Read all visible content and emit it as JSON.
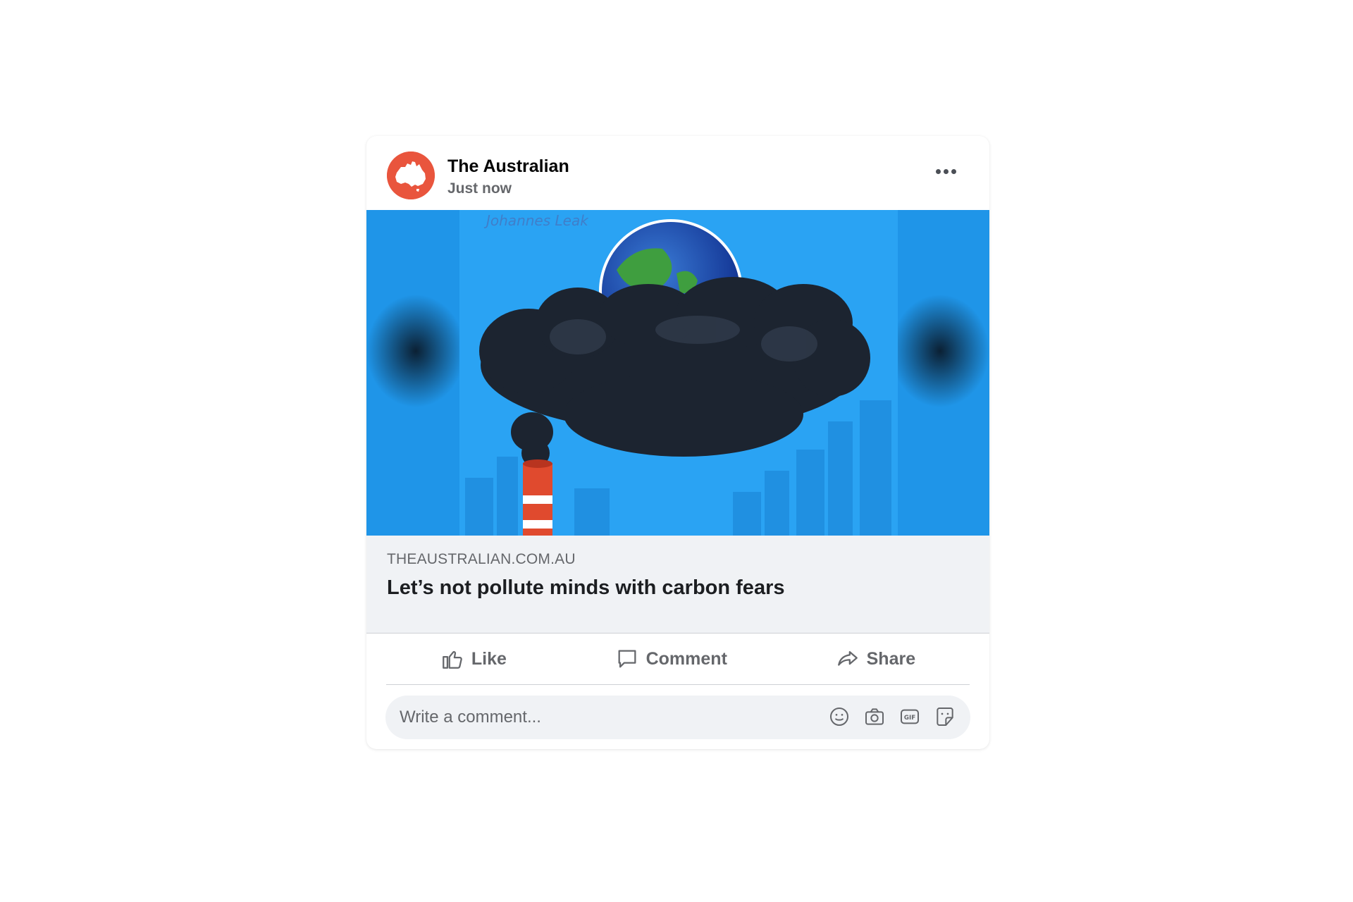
{
  "post": {
    "page_name": "The Australian",
    "timestamp": "Just now",
    "avatar_icon": "australia-map-icon",
    "more_icon": "more-options-icon"
  },
  "image": {
    "description_icon": "cartoon-earth-smoke-cloud-image",
    "signature": "Johannes Leak"
  },
  "link": {
    "domain": "THEAUSTRALIAN.COM.AU",
    "title": "Let’s not pollute minds with carbon fears"
  },
  "actions": {
    "like_label": "Like",
    "comment_label": "Comment",
    "share_label": "Share"
  },
  "comment": {
    "placeholder": "Write a comment...",
    "icons": [
      "emoji-icon",
      "camera-icon",
      "gif-icon",
      "sticker-icon"
    ]
  },
  "colors": {
    "brand": "#e9553d",
    "sky": "#2aa0f0",
    "text_secondary": "#65676b"
  }
}
